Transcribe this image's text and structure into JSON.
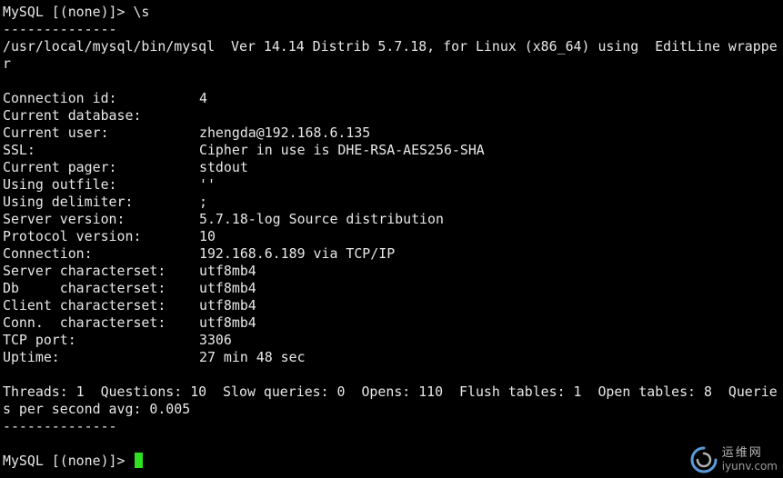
{
  "colors": {
    "background": "#000000",
    "text": "#e8e8e8",
    "cursor": "#2fe022"
  },
  "terminal": {
    "command_line": "MySQL [(none)]> \\s",
    "separator_top": "--------------",
    "client_info_line1": "/usr/local/mysql/bin/mysql  Ver 14.14 Distrib 5.7.18, for Linux (x86_64) using  EditLine wrappe",
    "client_info_line2": "r",
    "status": [
      {
        "key": "Connection id:",
        "value": "4"
      },
      {
        "key": "Current database:",
        "value": ""
      },
      {
        "key": "Current user:",
        "value": "zhengda@192.168.6.135"
      },
      {
        "key": "SSL:",
        "value": "Cipher in use is DHE-RSA-AES256-SHA"
      },
      {
        "key": "Current pager:",
        "value": "stdout"
      },
      {
        "key": "Using outfile:",
        "value": "''"
      },
      {
        "key": "Using delimiter:",
        "value": ";"
      },
      {
        "key": "Server version:",
        "value": "5.7.18-log Source distribution"
      },
      {
        "key": "Protocol version:",
        "value": "10"
      },
      {
        "key": "Connection:",
        "value": "192.168.6.189 via TCP/IP"
      },
      {
        "key": "Server characterset:",
        "value": "utf8mb4"
      },
      {
        "key": "Db     characterset:",
        "value": "utf8mb4"
      },
      {
        "key": "Client characterset:",
        "value": "utf8mb4"
      },
      {
        "key": "Conn.  characterset:",
        "value": "utf8mb4"
      },
      {
        "key": "TCP port:",
        "value": "3306"
      },
      {
        "key": "Uptime:",
        "value": "27 min 48 sec"
      }
    ],
    "threads_line1": "Threads: 1  Questions: 10  Slow queries: 0  Opens: 110  Flush tables: 1  Open tables: 8  Querie",
    "threads_line2": "s per second avg: 0.005",
    "separator_bottom": "--------------",
    "prompt": "MySQL [(none)]> "
  },
  "watermark": {
    "logo_icon": "swirl-logo-icon",
    "chinese_text": "运维网",
    "url_text": "iyunv.com"
  }
}
